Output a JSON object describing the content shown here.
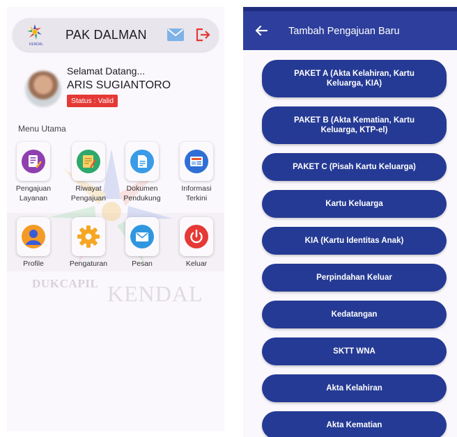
{
  "left": {
    "header": {
      "title": "PAK DALMAN",
      "logo_caption": "KENDAL"
    },
    "user": {
      "greeting": "Selamat Datang...",
      "name": "ARIS SUGIANTORO",
      "status": "Status : Valid"
    },
    "menu_title": "Menu Utama",
    "menu": [
      {
        "line1": "Pengajuan",
        "line2": "Layanan"
      },
      {
        "line1": "Riwayat",
        "line2": "Pengajuan"
      },
      {
        "line1": "Dokumen",
        "line2": "Pendukung"
      },
      {
        "line1": "Informasi",
        "line2": "Terkini"
      },
      {
        "line1": "Profile",
        "line2": ""
      },
      {
        "line1": "Pengaturan",
        "line2": ""
      },
      {
        "line1": "Pesan",
        "line2": ""
      },
      {
        "line1": "Keluar",
        "line2": ""
      }
    ],
    "watermark": {
      "part1": "DUKCAPIL",
      "part2": "KENDAL"
    }
  },
  "right": {
    "title": "Tambah Pengajuan Baru",
    "buttons": [
      "PAKET A (Akta Kelahiran, Kartu Keluarga, KIA)",
      "PAKET B (Akta Kematian, Kartu Keluarga, KTP-el)",
      "PAKET C (Pisah Kartu Keluarga)",
      "Kartu Keluarga",
      "KIA (Kartu Identitas Anak)",
      "Perpindahan Keluar",
      "Kedatangan",
      "SKTT WNA",
      "Akta Kelahiran",
      "Akta Kematian"
    ]
  },
  "colors": {
    "primary": "#253a94",
    "header_bg": "#2d3e9c",
    "status_badge": "#e53935",
    "mail": "#7fb2e6",
    "logout": "#e53935"
  },
  "icons": {
    "header": [
      "app-logo",
      "mail-icon",
      "logout-icon"
    ],
    "menu": [
      "edit-document-icon",
      "history-note-icon",
      "document-icon",
      "news-icon",
      "profile-icon",
      "settings-gear-icon",
      "mail-icon",
      "power-icon"
    ],
    "right": [
      "back-arrow-icon"
    ]
  }
}
